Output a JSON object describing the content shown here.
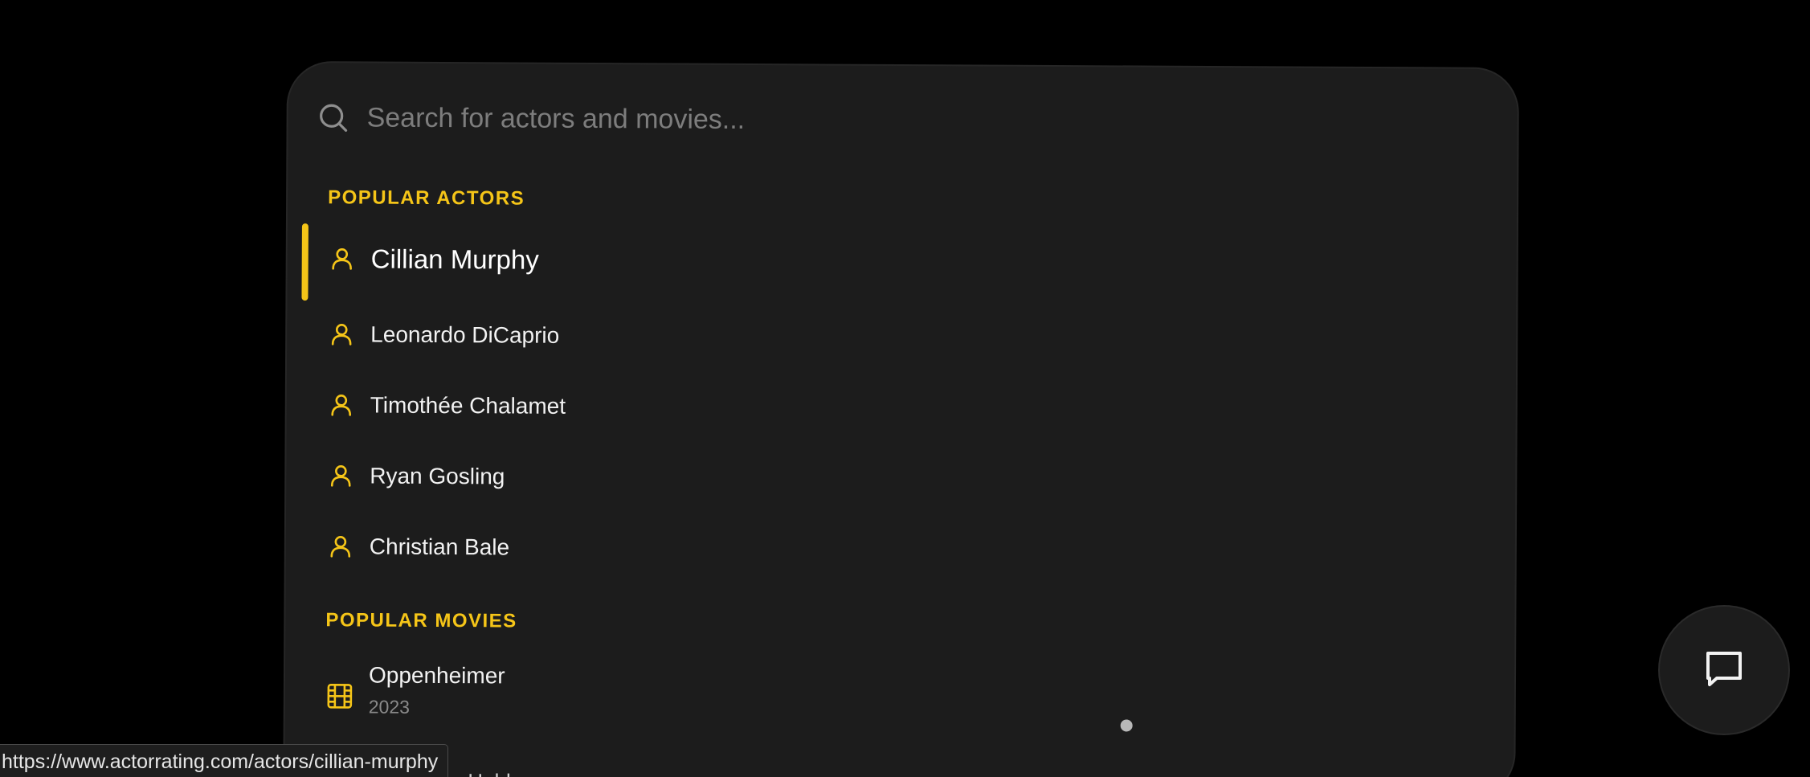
{
  "search": {
    "placeholder": "Search for actors and movies...",
    "value": ""
  },
  "sections": {
    "actors_title": "POPULAR ACTORS",
    "movies_title": "POPULAR MOVIES"
  },
  "actors": [
    {
      "name": "Cillian Murphy",
      "selected": true
    },
    {
      "name": "Leonardo DiCaprio",
      "selected": false
    },
    {
      "name": "Timothée Chalamet",
      "selected": false
    },
    {
      "name": "Ryan Gosling",
      "selected": false
    },
    {
      "name": "Christian Bale",
      "selected": false
    }
  ],
  "movies": [
    {
      "title": "Oppenheimer",
      "year": "2023"
    }
  ],
  "clipped_text": "Holdovers",
  "status_bar": {
    "url": "https://www.actorrating.com/actors/cillian-murphy"
  },
  "colors": {
    "accent": "#f5c518",
    "panel": "#1c1c1c",
    "background": "#000000",
    "muted_text": "#8a8a8a"
  },
  "icons": {
    "search": "search-icon",
    "actor": "user-icon",
    "movie": "film-icon",
    "chat": "chat-bubble-icon"
  }
}
